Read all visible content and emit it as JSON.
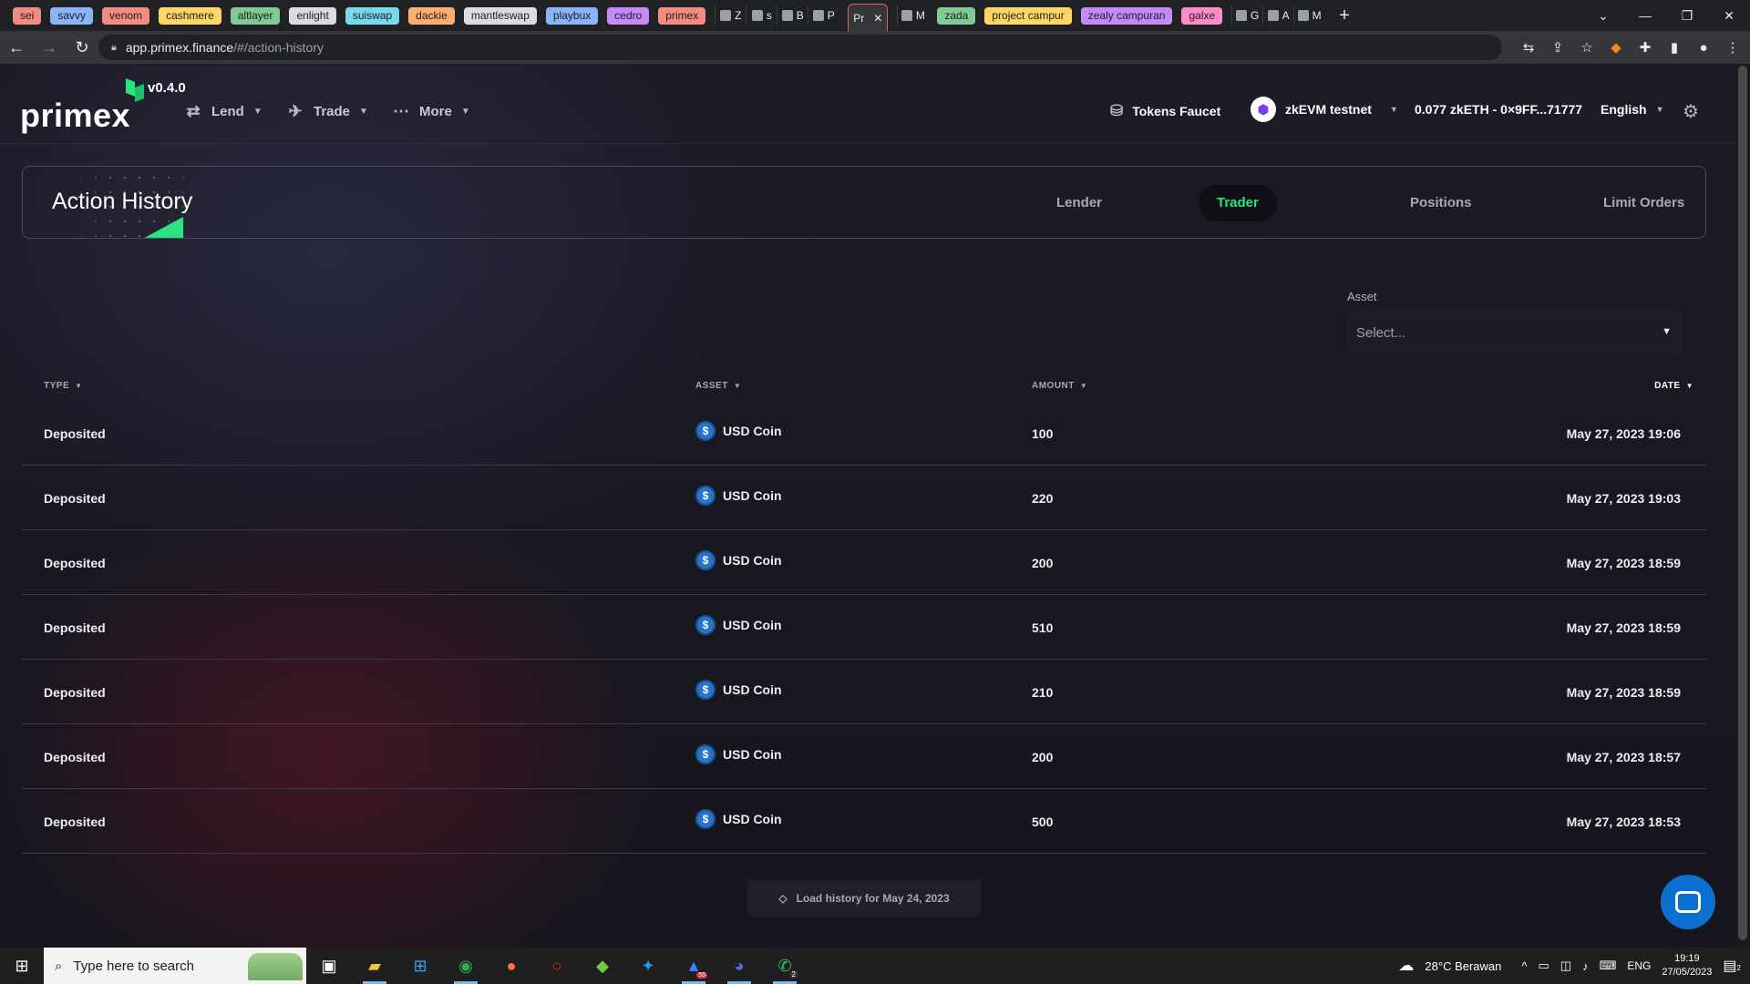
{
  "browser": {
    "tab_chips": [
      {
        "label": "sei",
        "color": "#f28b82"
      },
      {
        "label": "savvy",
        "color": "#8ab4f8"
      },
      {
        "label": "venom",
        "color": "#f28b82"
      },
      {
        "label": "cashmere",
        "color": "#fdd663"
      },
      {
        "label": "altlayer",
        "color": "#81c995"
      },
      {
        "label": "enlight",
        "color": "#dadce0"
      },
      {
        "label": "suiswap",
        "color": "#78d9ec"
      },
      {
        "label": "dackie",
        "color": "#fcad70"
      },
      {
        "label": "mantleswap",
        "color": "#dadce0"
      },
      {
        "label": "playbux",
        "color": "#8ab4f8"
      },
      {
        "label": "cedro",
        "color": "#c58af9"
      },
      {
        "label": "primex",
        "color": "#f28b82"
      }
    ],
    "mini_tabs_a": [
      "Z",
      "s",
      "B",
      "P"
    ],
    "active_tab_label": "Pr",
    "mini_tabs_b": [
      "M"
    ],
    "tab_chips_b": [
      {
        "label": "zada",
        "color": "#81c995"
      },
      {
        "label": "project campur",
        "color": "#fdd663"
      },
      {
        "label": "zealy campuran",
        "color": "#c58af9"
      },
      {
        "label": "galxe",
        "color": "#ff8bcb"
      }
    ],
    "mini_tabs_c": [
      "G",
      "A",
      "M"
    ],
    "url_host": "app.primex.finance",
    "url_path": "/#/action-history"
  },
  "app": {
    "logo_text": "primex",
    "version": "v0.4.0",
    "nav": {
      "lend": "Lend",
      "trade": "Trade",
      "more": "More"
    },
    "faucet_label": "Tokens Faucet",
    "network_label": "zkEVM testnet",
    "wallet_label": "0.077 zkETH - 0×9FF...71777",
    "language_label": "English"
  },
  "page": {
    "title": "Action History",
    "tabs": {
      "lender": "Lender",
      "trader": "Trader",
      "positions": "Positions",
      "limit_orders": "Limit Orders"
    },
    "active_tab": "Trader",
    "filter": {
      "label": "Asset",
      "placeholder": "Select..."
    }
  },
  "table": {
    "columns": {
      "type": "TYPE",
      "asset": "ASSET",
      "amount": "AMOUNT",
      "date": "DATE"
    },
    "rows": [
      {
        "type": "Deposited",
        "asset": "USD Coin",
        "amount": "100",
        "date": "May 27, 2023 19:06"
      },
      {
        "type": "Deposited",
        "asset": "USD Coin",
        "amount": "220",
        "date": "May 27, 2023 19:03"
      },
      {
        "type": "Deposited",
        "asset": "USD Coin",
        "amount": "200",
        "date": "May 27, 2023 18:59"
      },
      {
        "type": "Deposited",
        "asset": "USD Coin",
        "amount": "510",
        "date": "May 27, 2023 18:59"
      },
      {
        "type": "Deposited",
        "asset": "USD Coin",
        "amount": "210",
        "date": "May 27, 2023 18:59"
      },
      {
        "type": "Deposited",
        "asset": "USD Coin",
        "amount": "200",
        "date": "May 27, 2023 18:57"
      },
      {
        "type": "Deposited",
        "asset": "USD Coin",
        "amount": "500",
        "date": "May 27, 2023 18:53"
      }
    ],
    "load_history_label": "Load history for May 24, 2023"
  },
  "taskbar": {
    "search_placeholder": "Type here to search",
    "badges": {
      "app_badge": "55",
      "whatsapp_badge": "2",
      "notifications": "2"
    },
    "weather": "28°C  Berawan",
    "language": "ENG",
    "time": "19:19",
    "date": "27/05/2023"
  },
  "colors": {
    "accent_green": "#2ae57f",
    "background": "#161620",
    "chat_blue": "#0d6fd1",
    "usdc_blue": "#2775ca"
  }
}
